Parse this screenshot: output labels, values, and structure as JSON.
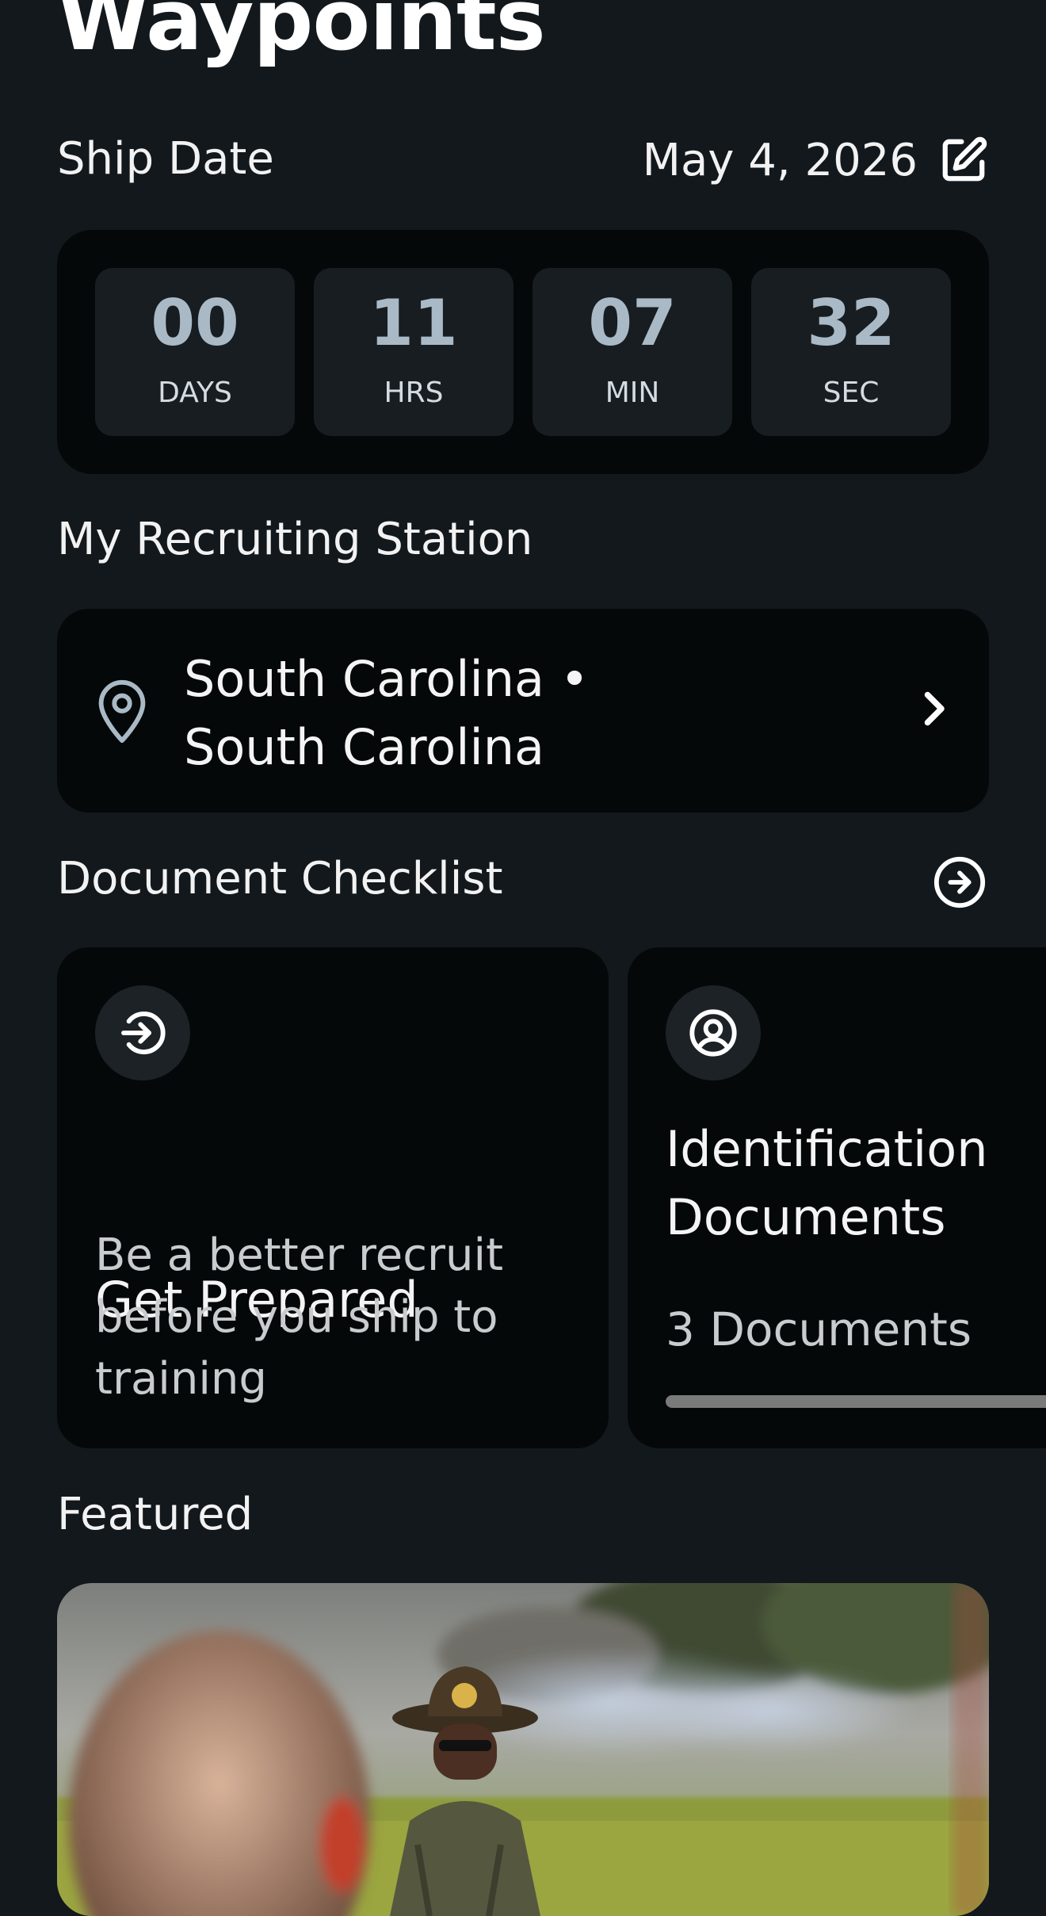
{
  "page": {
    "title": "Waypoints"
  },
  "ship": {
    "label": "Ship Date",
    "date": "May 4, 2026",
    "edit_icon": "edit-square-icon"
  },
  "countdown": [
    {
      "value": "00",
      "unit": "DAYS"
    },
    {
      "value": "11",
      "unit": "HRS"
    },
    {
      "value": "07",
      "unit": "MIN"
    },
    {
      "value": "32",
      "unit": "SEC"
    }
  ],
  "station": {
    "section_label": "My Recruiting Station",
    "line1": "South Carolina •",
    "line2": "South Carolina",
    "icon": "map-pin-icon",
    "chevron": "chevron-right-icon"
  },
  "checklist": {
    "section_label": "Document Checklist",
    "action_icon": "arrow-right-circle-icon",
    "cards": [
      {
        "icon": "sign-in-arrow-icon",
        "title": "Get Prepared",
        "description": "Be a better recruit before you ship to training"
      },
      {
        "icon": "user-circle-icon",
        "title_line1": "Identification",
        "title_line2": "Documents",
        "count": "3 Documents",
        "progress": 0
      }
    ]
  },
  "featured": {
    "section_label": "Featured",
    "image_subject": "drill-instructor-photo"
  },
  "colors": {
    "background": "#13181c",
    "card": "#050808",
    "countdown_box": "#181d21",
    "countdown_number": "#a9bac6"
  }
}
